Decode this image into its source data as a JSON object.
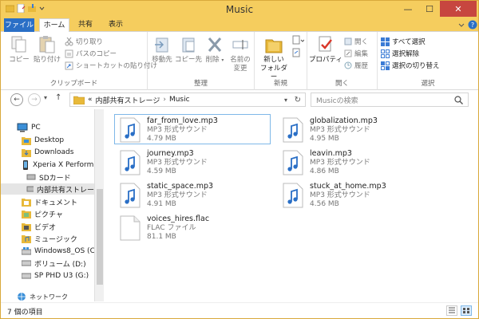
{
  "window": {
    "title": "Music"
  },
  "window_controls": {
    "minimize": "—",
    "maximize": "☐",
    "close": "✕"
  },
  "tabs": [
    {
      "label": "ファイル"
    },
    {
      "label": "ホーム"
    },
    {
      "label": "共有"
    },
    {
      "label": "表示"
    }
  ],
  "ribbon": {
    "clipboard": {
      "copy": "コピー",
      "paste": "貼り付け",
      "cut": "切り取り",
      "copy_path": "パスのコピー",
      "paste_shortcut": "ショートカットの貼り付け",
      "label": "クリップボード"
    },
    "organize": {
      "move_to": "移動先",
      "copy_to": "コピー先",
      "delete": "削除",
      "rename_line1": "名前の",
      "rename_line2": "変更",
      "label": "整理"
    },
    "new": {
      "new_folder_line1": "新しい",
      "new_folder_line2": "フォルダー",
      "label": "新規"
    },
    "open": {
      "properties": "プロパティ",
      "open": "開く",
      "edit": "編集",
      "history": "履歴",
      "label": "開く"
    },
    "select": {
      "select_all": "すべて選択",
      "select_none": "選択解除",
      "invert": "選択の切り替え",
      "label": "選択"
    }
  },
  "address": {
    "overflow": "«",
    "crumbs": [
      "内部共有ストレージ",
      "Music"
    ],
    "search_placeholder": "Musicの検索"
  },
  "navigation": [
    {
      "label": "PC",
      "icon": "pc-icon"
    },
    {
      "label": "Desktop",
      "icon": "desktop-folder-icon"
    },
    {
      "label": "Downloads",
      "icon": "downloads-folder-icon"
    },
    {
      "label": "Xperia X Perform",
      "icon": "phone-icon"
    },
    {
      "label": "SDカード",
      "icon": "sd-card-icon"
    },
    {
      "label": "内部共有ストレー",
      "icon": "storage-icon"
    },
    {
      "label": "ドキュメント",
      "icon": "documents-folder-icon"
    },
    {
      "label": "ピクチャ",
      "icon": "pictures-folder-icon"
    },
    {
      "label": "ビデオ",
      "icon": "videos-folder-icon"
    },
    {
      "label": "ミュージック",
      "icon": "music-folder-icon"
    },
    {
      "label": "Windows8_OS (C",
      "icon": "windows-drive-icon"
    },
    {
      "label": "ボリューム (D:)",
      "icon": "drive-icon"
    },
    {
      "label": "SP PHD U3 (G:)",
      "icon": "usb-drive-icon"
    },
    {
      "label": "ネットワーク",
      "icon": "network-icon"
    }
  ],
  "files": [
    {
      "name": "far_from_love.mp3",
      "type": "MP3 形式サウンド",
      "size": "4.79 MB",
      "icon": "mp3-file-icon"
    },
    {
      "name": "globalization.mp3",
      "type": "MP3 形式サウンド",
      "size": "4.95 MB",
      "icon": "mp3-file-icon"
    },
    {
      "name": "journey.mp3",
      "type": "MP3 形式サウンド",
      "size": "4.59 MB",
      "icon": "mp3-file-icon"
    },
    {
      "name": "leavin.mp3",
      "type": "MP3 形式サウンド",
      "size": "4.86 MB",
      "icon": "mp3-file-icon"
    },
    {
      "name": "static_space.mp3",
      "type": "MP3 形式サウンド",
      "size": "4.91 MB",
      "icon": "mp3-file-icon"
    },
    {
      "name": "stuck_at_home.mp3",
      "type": "MP3 形式サウンド",
      "size": "4.56 MB",
      "icon": "mp3-file-icon"
    },
    {
      "name": "voices_hires.flac",
      "type": "FLAC ファイル",
      "size": "81.1 MB",
      "icon": "flac-file-icon"
    }
  ],
  "status": {
    "count": "7 個の項目"
  },
  "colors": {
    "title_bar": "#f5cd5e",
    "file_tab": "#2a6fc6",
    "close_button": "#c7463f",
    "selection_border": "#7fb8e8"
  }
}
